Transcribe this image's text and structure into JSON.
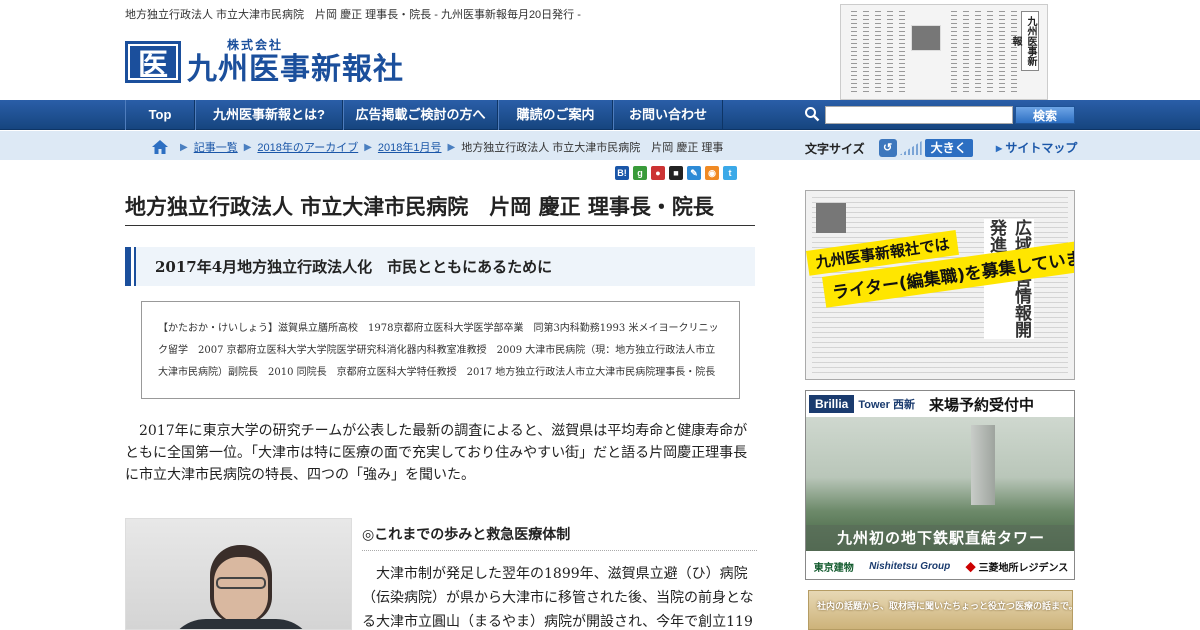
{
  "header": {
    "tagline": "地方独立行政法人 市立大津市民病院　片岡 慶正 理事長・院長 - 九州医事新報毎月20日発行 -",
    "logo_mark": "医",
    "logo_sub": "株式会社",
    "logo_main": "九州医事新報社",
    "newspaper_masthead": "九州医事新報"
  },
  "nav": {
    "items": [
      {
        "label": "Top"
      },
      {
        "label": "九州医事新報とは?"
      },
      {
        "label": "広告掲載ご検討の方へ"
      },
      {
        "label": "購読のご案内"
      },
      {
        "label": "お問い合わせ"
      }
    ],
    "search_button": "検索",
    "search_placeholder": ""
  },
  "breadcrumb": {
    "items": [
      "記事一覧",
      "2018年のアーカイブ",
      "2018年1月号"
    ],
    "current": "地方独立行政法人 市立大津市民病院　片岡 慶正 理事"
  },
  "fontsize": {
    "label": "文字サイズ",
    "large": "大きく",
    "sitemap": "サイトマップ"
  },
  "share_icons": [
    {
      "name": "hatena-bookmark-icon",
      "glyph": "B!",
      "color": "#1a56a8"
    },
    {
      "name": "google-bookmark-icon",
      "glyph": "g",
      "color": "#3a9b3a"
    },
    {
      "name": "livedoor-clip-icon",
      "glyph": "●",
      "color": "#c33"
    },
    {
      "name": "delicious-icon",
      "glyph": "■",
      "color": "#222"
    },
    {
      "name": "evernote-icon",
      "glyph": "✎",
      "color": "#2d8bd6"
    },
    {
      "name": "rss-icon",
      "glyph": "◉",
      "color": "#f08a24"
    },
    {
      "name": "twitter-icon",
      "glyph": "t",
      "color": "#3ba9e8"
    }
  ],
  "article": {
    "title": "地方独立行政法人 市立大津市民病院　片岡 慶正 理事長・院長",
    "subhead": "2017年4月地方独立行政法人化　市民とともにあるために",
    "profile": "【かたおか・けいしょう】滋賀県立膳所高校　1978京都府立医科大学医学部卒業　同第3内科勤務1993 米メイヨークリニック留学　2007 京都府立医科大学大学院医学研究科消化器内科教室准教授　2009 大津市民病院（現：地方独立行政法人市立大津市民病院）副院長　2010 同院長　京都府立医科大学特任教授　2017 地方独立行政法人市立大津市民病院理事長・院長",
    "lead": "2017年に東京大学の研究チームが公表した最新の調査によると、滋賀県は平均寿命と健康寿命がともに全国第一位。「大津市は特に医療の面で充実しており住みやすい街」だと語る片岡慶正理事長に市立大津市民病院の特長、四つの「強み」を聞いた。",
    "section_heading": "◎これまでの歩みと救急医療体制",
    "section_body": "大津市制が発足した翌年の1899年、滋賀県立避（ひ）病院（伝染病院）が県から大津市に移管された後、当院の前身となる大津市立圓山（まるやま）病院が開設され、今年で創立119"
  },
  "sidebar": {
    "ad1": {
      "line1": "九州医事新報社では",
      "line2": "ライター(編集職)を募集しています",
      "headline": "広域災害情報開発進む"
    },
    "ad2": {
      "brand": "Brillia",
      "tower": "Tower 西新",
      "visit": "来場予約受付中",
      "caption": "九州初の地下鉄駅直結タワー",
      "footer": [
        "東京建物",
        "Nishitetsu Group",
        "三菱地所レジデンス"
      ]
    },
    "ad3": {
      "text": "社内の話題から、取材時に聞いたちょっと役立つ医療の話まで。"
    }
  }
}
